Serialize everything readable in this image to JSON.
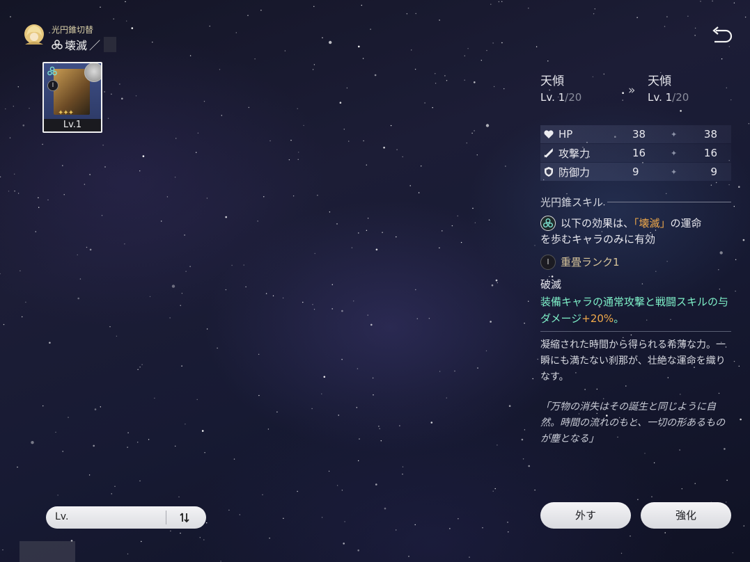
{
  "header": {
    "title": "光円錐切替",
    "path_name": "壊滅",
    "path_separator": "／",
    "avatar_icon": "character-avatar-icon",
    "path_icon": "destruction-path-icon",
    "back_icon": "back-arrow-icon"
  },
  "selected_card": {
    "level": "Lv.1",
    "rarity_stars": "✦✦✦",
    "rank": "I",
    "path_icon": "destruction-path-icon",
    "character_icon": "equipped-character-icon"
  },
  "detail": {
    "from": {
      "name": "天傾",
      "lv_label": "Lv.",
      "level": "1",
      "max": "/20"
    },
    "to": {
      "name": "天傾",
      "lv_label": "Lv.",
      "level": "1",
      "max": "/20"
    },
    "arrow": "»",
    "stats": [
      {
        "label": "HP",
        "from": "38",
        "to": "38",
        "icon": "hp-heart-icon"
      },
      {
        "label": "攻撃力",
        "from": "16",
        "to": "16",
        "icon": "attack-sword-icon"
      },
      {
        "label": "防御力",
        "from": "9",
        "to": "9",
        "icon": "defense-shield-icon"
      }
    ],
    "stat_arrow": "✦",
    "skill_header": "光円錐スキル",
    "condition": {
      "pre": "以下の効果は、",
      "highlight": "「壊滅」",
      "post": "の運命",
      "line2": "を歩むキャラのみに有効"
    },
    "rank": {
      "icon_text": "I",
      "label": "重畳ランク1"
    },
    "effect_name": "破滅",
    "effect_desc_main": "装備キャラの通常攻撃と戦闘スキルの与ダメージ",
    "effect_desc_value": "+20%",
    "effect_desc_end": "。",
    "lore": "凝縮された時間から得られる希薄な力。一瞬にも満たない刹那が、壮絶な運命を織りなす。",
    "quote": "「万物の消失はその誕生と同じように自然。時間の流れのもと、一切の形あるものが塵となる」"
  },
  "buttons": {
    "remove": "外す",
    "enhance": "強化"
  },
  "sort": {
    "label": "Lv.",
    "toggle_icon": "sort-order-icon"
  },
  "colors": {
    "highlight_orange": "#f0a94a",
    "effect_green": "#7ef0c8",
    "rank_gold": "#d7c49a"
  }
}
